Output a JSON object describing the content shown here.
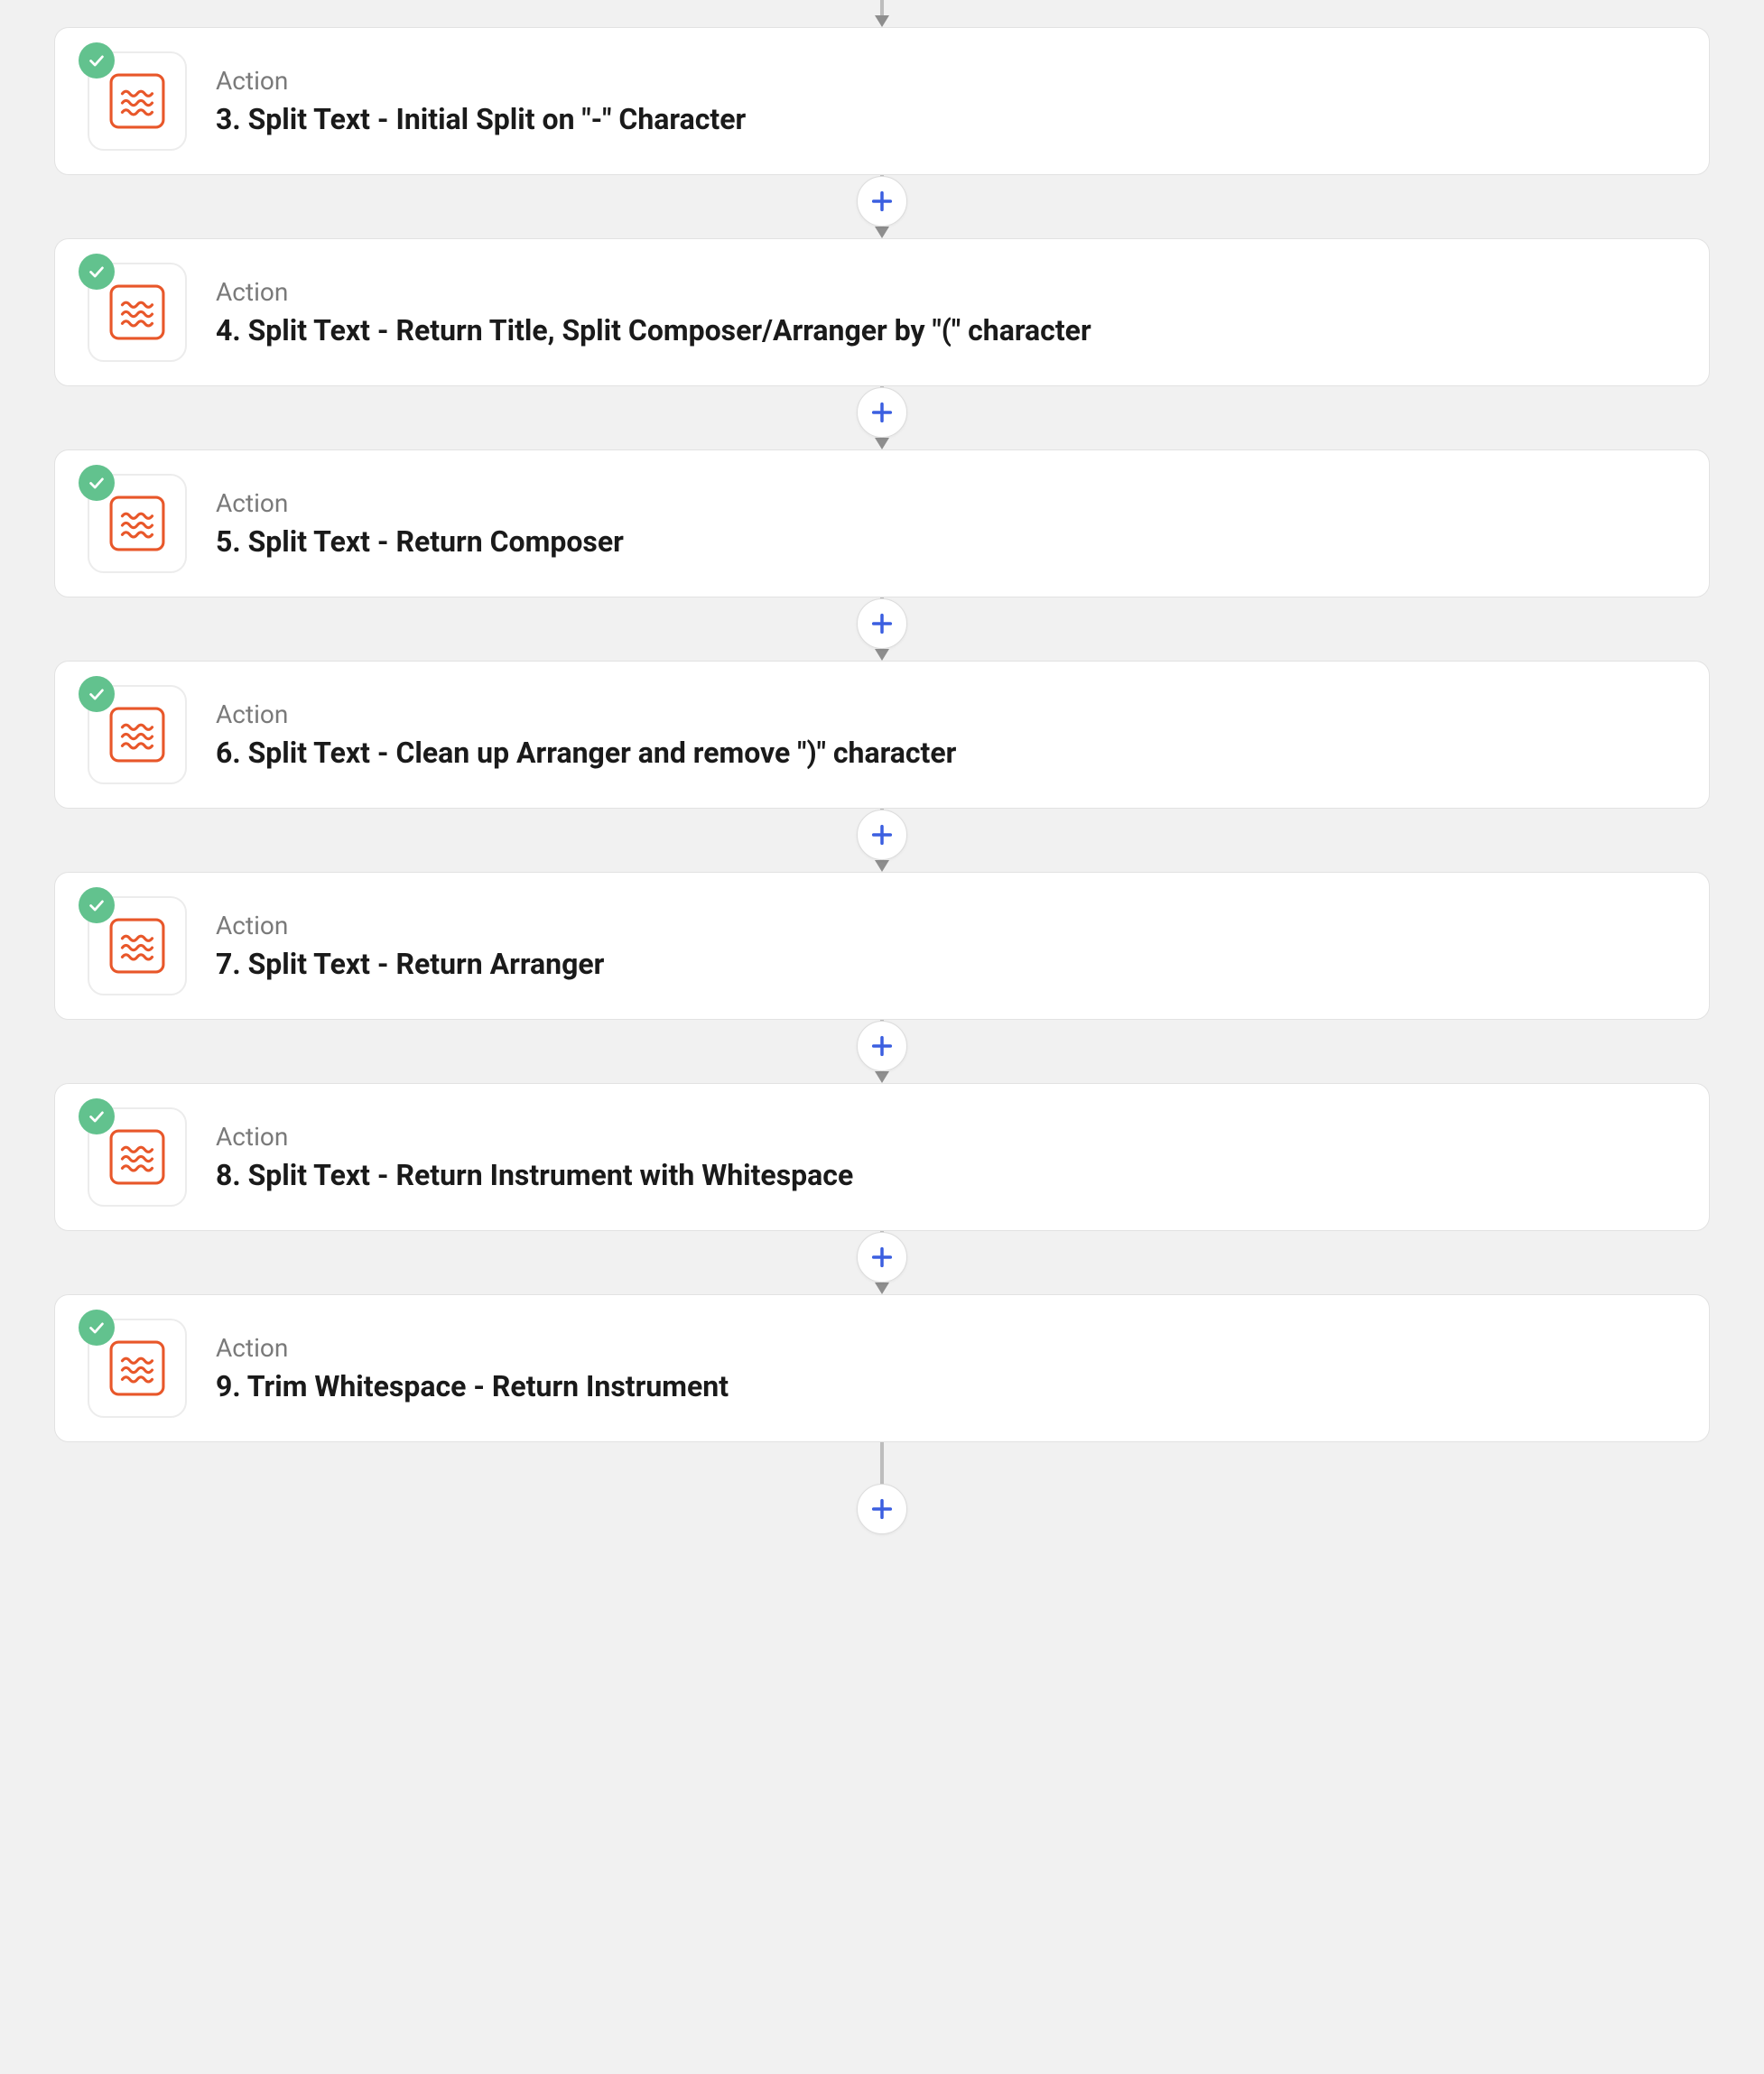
{
  "steps": [
    {
      "type": "Action",
      "title": "3. Split Text - Initial Split on \"-\" Character"
    },
    {
      "type": "Action",
      "title": "4. Split Text - Return Title, Split Composer/Arranger by \"(\" character"
    },
    {
      "type": "Action",
      "title": "5. Split Text - Return Composer"
    },
    {
      "type": "Action",
      "title": "6. Split Text - Clean up Arranger and remove \")\" character"
    },
    {
      "type": "Action",
      "title": "7. Split Text - Return Arranger"
    },
    {
      "type": "Action",
      "title": "8. Split Text - Return Instrument with Whitespace"
    },
    {
      "type": "Action",
      "title": "9. Trim Whitespace - Return Instrument"
    }
  ],
  "colors": {
    "formatter_orange": "#e8572a",
    "check_green": "#62c28e",
    "plus_blue": "#3b5fe0"
  }
}
